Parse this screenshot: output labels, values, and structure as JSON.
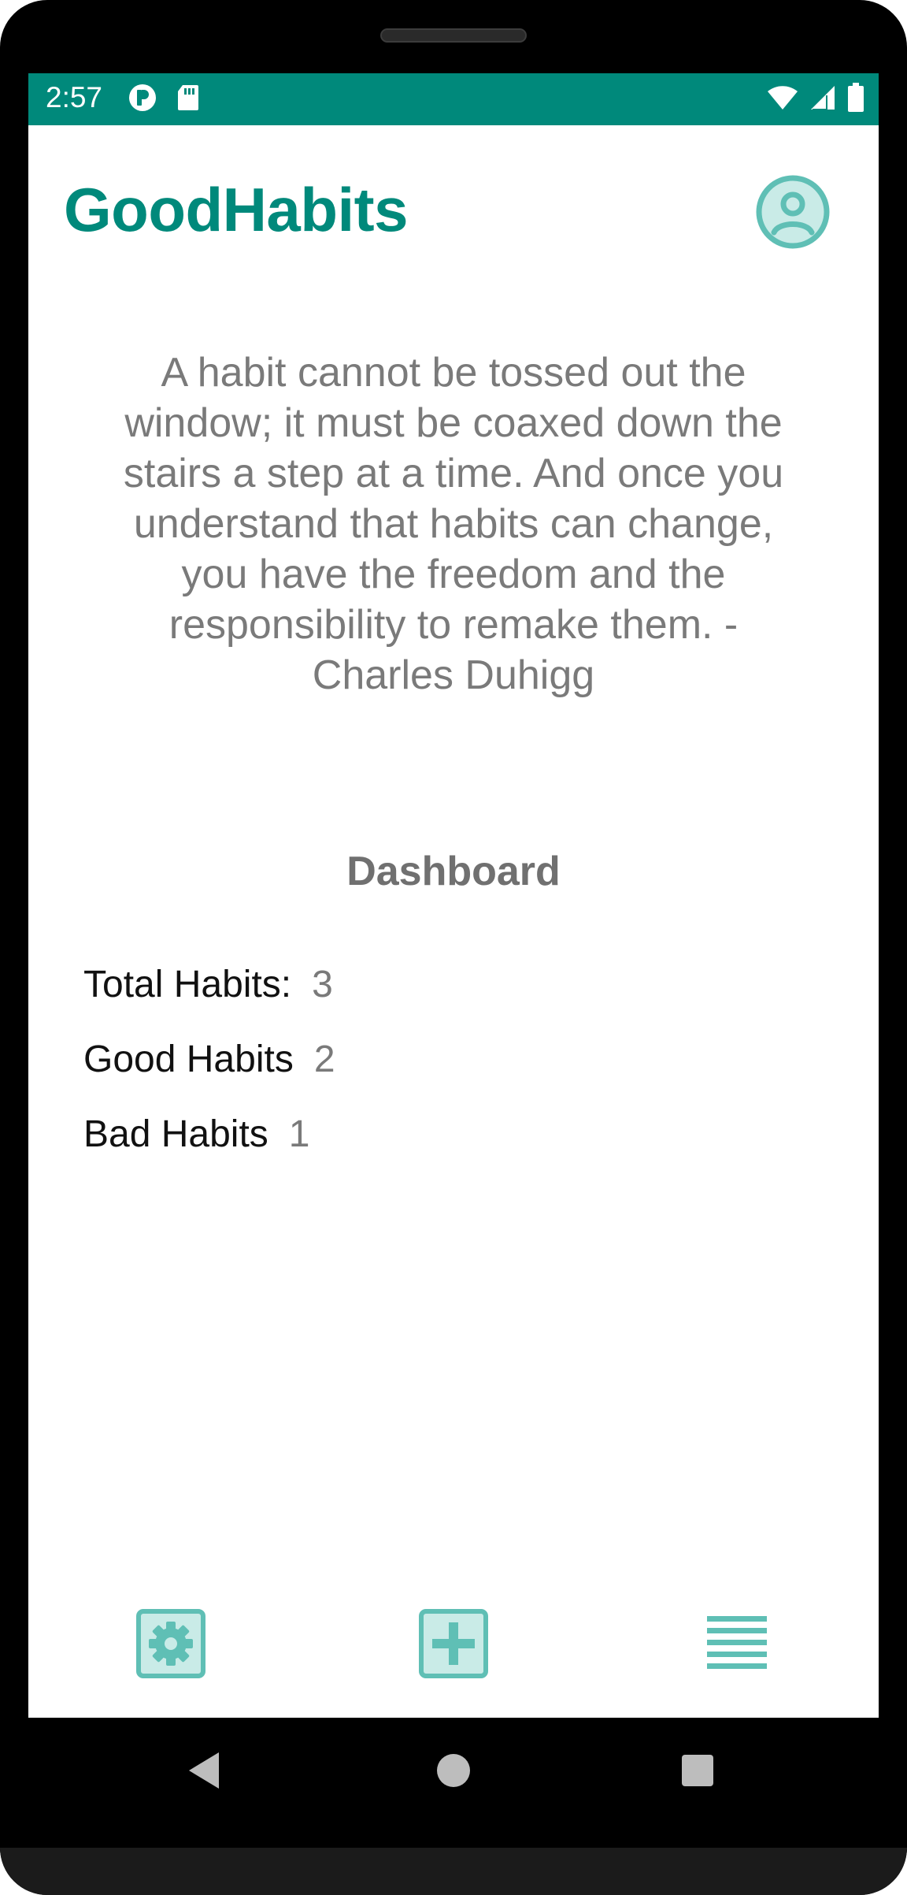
{
  "status_bar": {
    "time": "2:57",
    "left_icons": [
      "pocket-icon",
      "sd-card-icon"
    ],
    "right_icons": [
      "wifi-icon",
      "cell-signal-icon",
      "battery-icon"
    ],
    "background": "#00897b"
  },
  "header": {
    "title": "GoodHabits",
    "profile_icon": "account-circle-icon"
  },
  "quote": {
    "text": "A habit cannot be tossed out the window; it must be coaxed down the stairs a step at a time. And once you understand that habits can change, you have the freedom and the responsibility to remake them. - Charles Duhigg"
  },
  "dashboard": {
    "title": "Dashboard",
    "stats": [
      {
        "label": "Total Habits:",
        "value": "3"
      },
      {
        "label": "Good Habits",
        "value": "2"
      },
      {
        "label": "Bad Habits",
        "value": "1"
      }
    ]
  },
  "bottom_bar": {
    "buttons": [
      "settings-icon",
      "add-habit-icon",
      "habit-list-icon"
    ]
  },
  "theme": {
    "accent": "#00897b",
    "icon_teal": "#5fbfb5",
    "icon_fill": "#c9ebe7"
  }
}
